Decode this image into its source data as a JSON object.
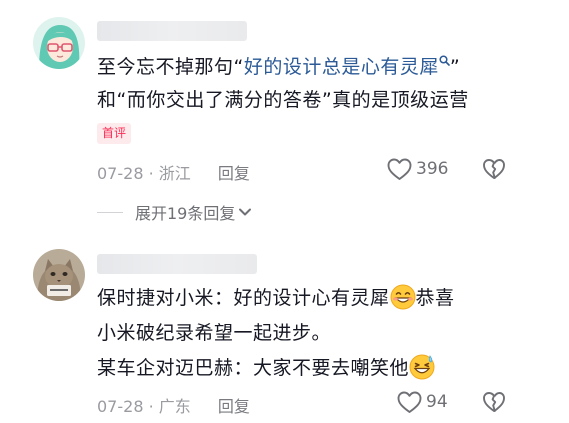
{
  "comments": [
    {
      "lines": [
        {
          "prefix": "至今忘不掉那句“",
          "link": "好的设计总是心有灵犀",
          "suffix": "”"
        },
        {
          "text": "和“而你交出了满分的答卷”真的是顶级运营"
        }
      ],
      "badge": "首评",
      "date": "07-28",
      "location": "浙江",
      "reply_label": "回复",
      "likes": "396"
    },
    {
      "lines": [
        {
          "before": "保时捷对小米：好的设计心有灵犀",
          "after": "恭喜"
        },
        {
          "text": "小米破纪录希望一起进步。"
        },
        {
          "text": "某车企对迈巴赫：大家不要去嘲笑他"
        }
      ],
      "date": "07-28",
      "location": "广东",
      "reply_label": "回复",
      "likes": "94"
    }
  ],
  "expand_replies": "展开19条回复",
  "icons": {
    "like": "heart-outline-icon",
    "dislike": "broken-heart-icon",
    "expand": "chevron-down-icon",
    "search": "search-icon",
    "emoji_grin": "grinning-face-emoji",
    "emoji_laugh_sweat": "grinning-sweat-emoji"
  },
  "colors": {
    "link": "#2b5a96",
    "badge_text": "#fe2c55",
    "badge_bg": "#fdeaec",
    "meta": "#9a9ba0"
  }
}
